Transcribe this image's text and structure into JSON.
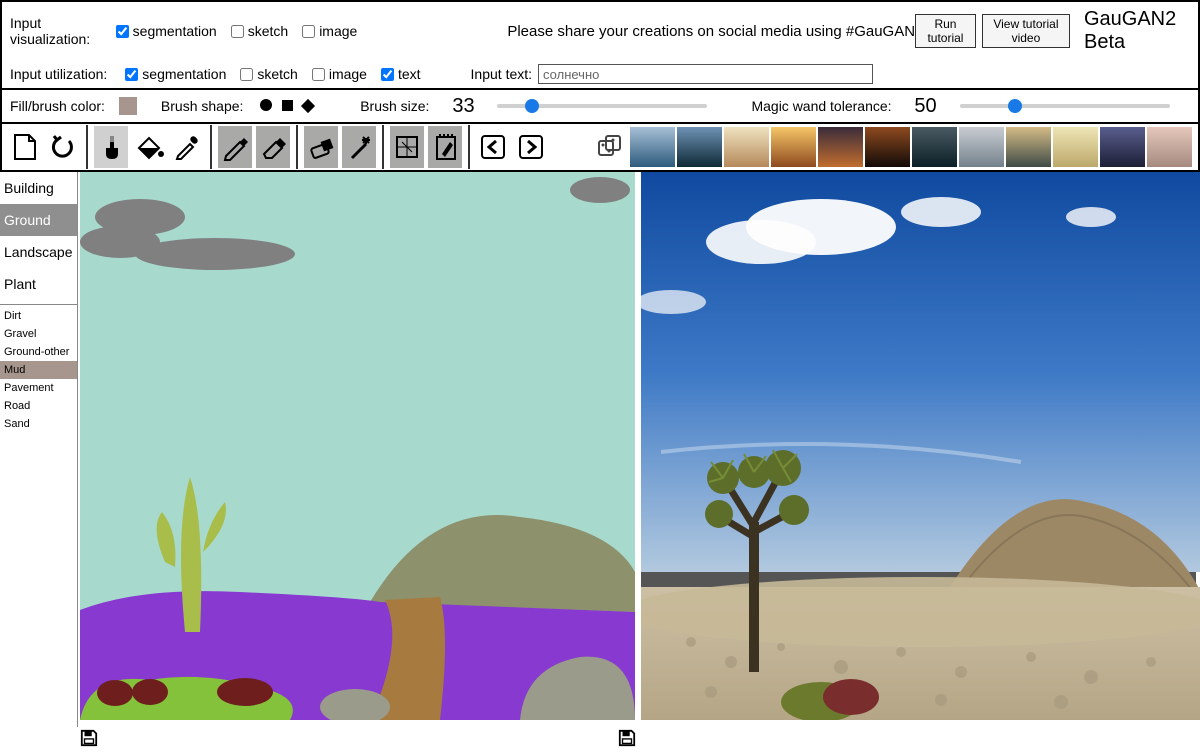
{
  "header": {
    "input_visualization_label": "Input visualization:",
    "input_utilization_label": "Input utilization:",
    "chk_segmentation": "segmentation",
    "chk_sketch": "sketch",
    "chk_image": "image",
    "chk_text": "text",
    "tagline": "Please share your creations on social media using #GauGAN",
    "run_tutorial": "Run tutorial",
    "view_tutorial": "View tutorial video",
    "app_name": "GauGAN2 Beta",
    "input_text_label": "Input text:",
    "input_text_value": "солнечно"
  },
  "brush": {
    "fill_label": "Fill/brush color:",
    "shape_label": "Brush shape:",
    "size_label": "Brush size:",
    "size_value": "33",
    "magic_label": "Magic wand tolerance:",
    "magic_value": "50",
    "swatch_color": "#a6968e"
  },
  "tools": {
    "new": "new-canvas",
    "undo": "undo",
    "brush": "brush",
    "fill": "fill",
    "picker": "color-picker",
    "pencil": "pencil",
    "eraser_sketch": "eraser-sketch",
    "eraser_seg": "eraser-seg",
    "magic": "magic-wand",
    "segmap": "seg-map",
    "palette": "palette",
    "arrow_left": "arrow-left",
    "arrow_right": "arrow-right",
    "dice": "dice"
  },
  "categories": {
    "main": [
      "Building",
      "Ground",
      "Landscape",
      "Plant"
    ],
    "selected_main": 1,
    "sub": [
      "Dirt",
      "Gravel",
      "Ground-other",
      "Mud",
      "Pavement",
      "Road",
      "Sand"
    ],
    "selected_sub": 3
  },
  "thumbnails": [
    {
      "g": [
        "#a7bfd6",
        "#2d5b7d"
      ]
    },
    {
      "g": [
        "#6e91b5",
        "#0f2a36"
      ]
    },
    {
      "g": [
        "#efe2c0",
        "#b5895a"
      ]
    },
    {
      "g": [
        "#f6c668",
        "#8e4a1f"
      ]
    },
    {
      "g": [
        "#3a2c3b",
        "#c26d2e"
      ]
    },
    {
      "g": [
        "#8e4a1f",
        "#120a08"
      ]
    },
    {
      "g": [
        "#4a5a63",
        "#0b1f26"
      ]
    },
    {
      "g": [
        "#c9cdd2",
        "#73818c"
      ]
    },
    {
      "g": [
        "#d4bb86",
        "#3f4b46"
      ]
    },
    {
      "g": [
        "#efe6b6",
        "#bca86a"
      ]
    },
    {
      "g": [
        "#5a5e8e",
        "#1c1f35"
      ]
    },
    {
      "g": [
        "#e5c8bb",
        "#a68a80"
      ]
    }
  ]
}
